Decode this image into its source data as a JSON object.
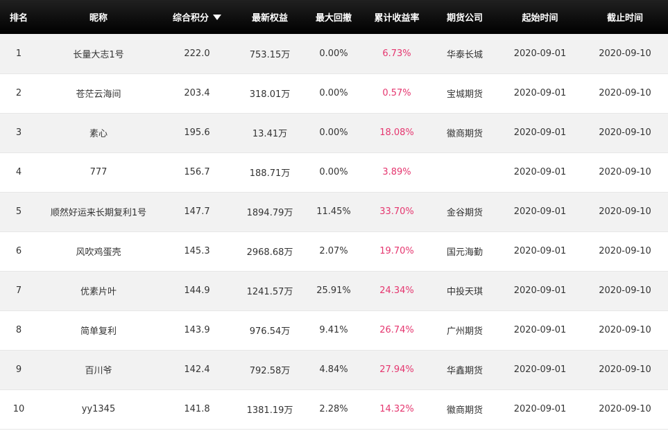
{
  "colors": {
    "header_bg": "#000000",
    "header_text": "#ffffff",
    "row_odd_bg": "#f2f2f2",
    "row_even_bg": "#ffffff",
    "rate_text": "#e5366f"
  },
  "header": {
    "rank": "排名",
    "nickname": "昵称",
    "score": "综合积分",
    "equity": "最新权益",
    "drawdown": "最大回撤",
    "return_rate": "累计收益率",
    "broker": "期货公司",
    "start_date": "起始时间",
    "end_date": "截止时间",
    "sort_icon": "triangle-down"
  },
  "rows": [
    {
      "rank": "1",
      "nickname": "长量大志1号",
      "score": "222.0",
      "equity": "753.15万",
      "drawdown": "0.00%",
      "return_rate": "6.73%",
      "broker": "华泰长城",
      "start_date": "2020-09-01",
      "end_date": "2020-09-10"
    },
    {
      "rank": "2",
      "nickname": "苍茫云海间",
      "score": "203.4",
      "equity": "318.01万",
      "drawdown": "0.00%",
      "return_rate": "0.57%",
      "broker": "宝城期货",
      "start_date": "2020-09-01",
      "end_date": "2020-09-10"
    },
    {
      "rank": "3",
      "nickname": "素心",
      "score": "195.6",
      "equity": "13.41万",
      "drawdown": "0.00%",
      "return_rate": "18.08%",
      "broker": "徽商期货",
      "start_date": "2020-09-01",
      "end_date": "2020-09-10"
    },
    {
      "rank": "4",
      "nickname": "777",
      "score": "156.7",
      "equity": "188.71万",
      "drawdown": "0.00%",
      "return_rate": "3.89%",
      "broker": "",
      "start_date": "2020-09-01",
      "end_date": "2020-09-10"
    },
    {
      "rank": "5",
      "nickname": "顺然好运来长期复利1号",
      "score": "147.7",
      "equity": "1894.79万",
      "drawdown": "11.45%",
      "return_rate": "33.70%",
      "broker": "金谷期货",
      "start_date": "2020-09-01",
      "end_date": "2020-09-10"
    },
    {
      "rank": "6",
      "nickname": "风吹鸡蛋壳",
      "score": "145.3",
      "equity": "2968.68万",
      "drawdown": "2.07%",
      "return_rate": "19.70%",
      "broker": "国元海勤",
      "start_date": "2020-09-01",
      "end_date": "2020-09-10"
    },
    {
      "rank": "7",
      "nickname": "优素片叶",
      "score": "144.9",
      "equity": "1241.57万",
      "drawdown": "25.91%",
      "return_rate": "24.34%",
      "broker": "中投天琪",
      "start_date": "2020-09-01",
      "end_date": "2020-09-10"
    },
    {
      "rank": "8",
      "nickname": "简单复利",
      "score": "143.9",
      "equity": "976.54万",
      "drawdown": "9.41%",
      "return_rate": "26.74%",
      "broker": "广州期货",
      "start_date": "2020-09-01",
      "end_date": "2020-09-10"
    },
    {
      "rank": "9",
      "nickname": "百川爷",
      "score": "142.4",
      "equity": "792.58万",
      "drawdown": "4.84%",
      "return_rate": "27.94%",
      "broker": "华鑫期货",
      "start_date": "2020-09-01",
      "end_date": "2020-09-10"
    },
    {
      "rank": "10",
      "nickname": "yy1345",
      "score": "141.8",
      "equity": "1381.19万",
      "drawdown": "2.28%",
      "return_rate": "14.32%",
      "broker": "徽商期货",
      "start_date": "2020-09-01",
      "end_date": "2020-09-10"
    }
  ]
}
